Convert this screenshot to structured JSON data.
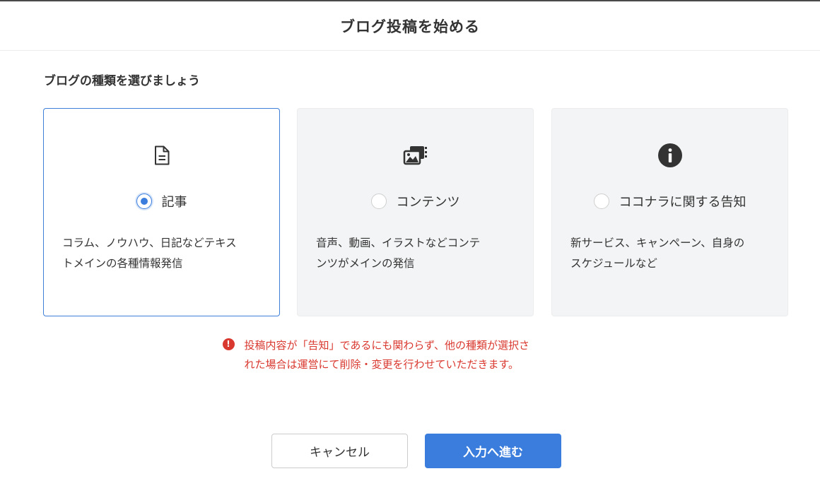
{
  "header": {
    "title": "ブログ投稿を始める"
  },
  "section_title": "ブログの種類を選びましょう",
  "cards": [
    {
      "label": "記事",
      "icon": "document-icon",
      "selected": true,
      "desc_line1": "コラム、ノウハウ、日記などテキス",
      "desc_line2": "トメインの各種情報発信"
    },
    {
      "label": "コンテンツ",
      "icon": "media-icon",
      "selected": false,
      "desc_line1": "音声、動画、イラストなどコンテ",
      "desc_line2": "ンツがメインの発信"
    },
    {
      "label": "ココナラに関する告知",
      "icon": "info-icon",
      "selected": false,
      "desc_line1": "新サービス、キャンペーン、自身の",
      "desc_line2": "スケジュールなど"
    }
  ],
  "notice": {
    "icon": "!",
    "line1": "投稿内容が「告知」であるにも関わらず、他の種類が選択さ",
    "line2": "れた場合は運営にて削除・変更を行わせていただきます。"
  },
  "buttons": {
    "cancel": "キャンセル",
    "next": "入力へ進む"
  },
  "colors": {
    "accent": "#3b7ddd",
    "warning": "#d9382f",
    "card_bg": "#f3f4f5"
  }
}
